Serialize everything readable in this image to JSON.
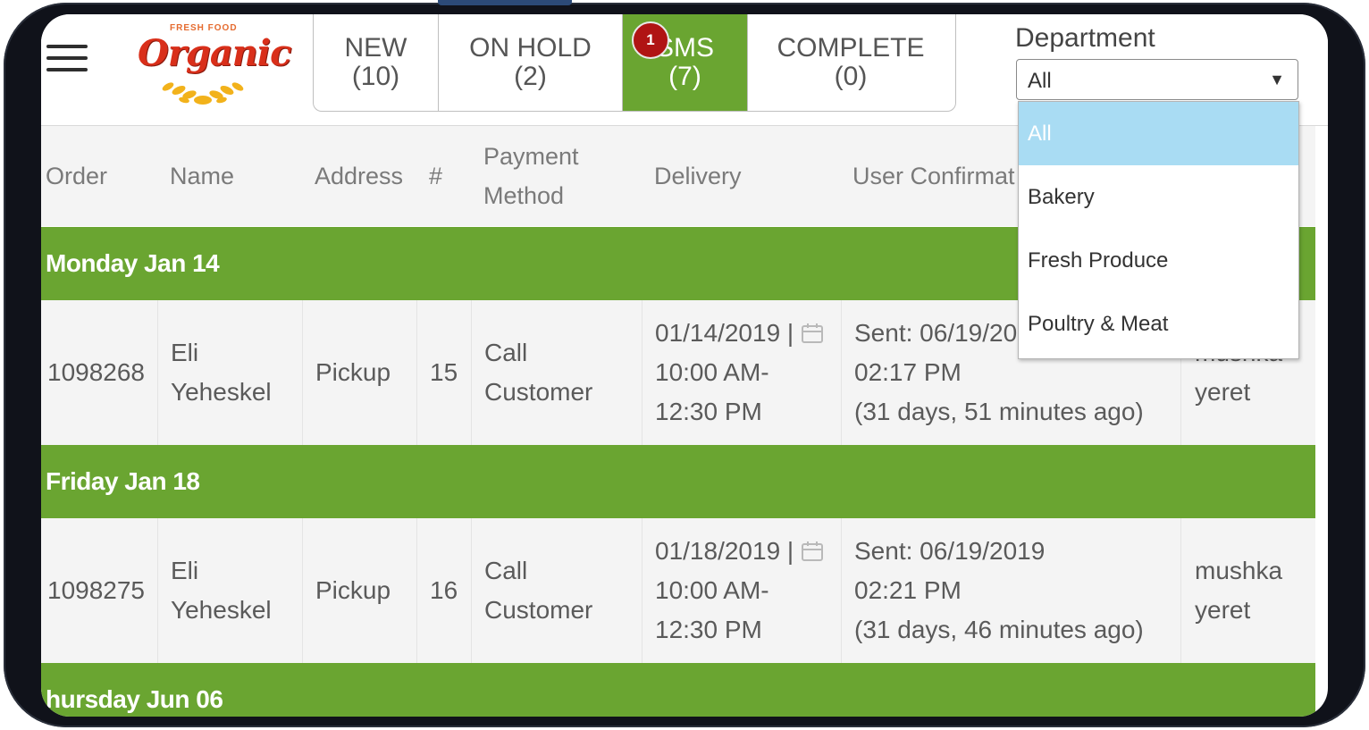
{
  "header": {
    "logo_small": "FRESH FOOD",
    "logo_word": "Organic",
    "tabs": [
      {
        "name": "NEW",
        "count": "(10)"
      },
      {
        "name": "ON HOLD",
        "count": "(2)"
      },
      {
        "name": "SMS",
        "count": "(7)",
        "badge": "1"
      },
      {
        "name": "COMPLETE",
        "count": "(0)"
      }
    ],
    "department": {
      "label": "Department",
      "selected": "All",
      "options": [
        "All",
        "Bakery",
        "Fresh Produce",
        "Poultry & Meat"
      ]
    }
  },
  "table": {
    "columns": [
      "Order",
      "Name",
      "Address",
      "#",
      "Payment Method",
      "Delivery",
      "User Confirmat"
    ],
    "groups": [
      {
        "label": "Monday Jan 14",
        "rows": [
          {
            "order": "1098268",
            "name": "Eli Yeheskel",
            "address": "Pickup",
            "num": "15",
            "payment": "Call Customer",
            "delivery_date": "01/14/2019 |",
            "delivery_time1": "10:00 AM-",
            "delivery_time2": "12:30 PM",
            "sent1": "Sent: 06/19/20",
            "sent2": "02:17 PM",
            "sent3": "(31 days, 51 minutes ago)",
            "user1": "mushka",
            "user2": "yeret"
          }
        ]
      },
      {
        "label": "Friday Jan 18",
        "rows": [
          {
            "order": "1098275",
            "name": "Eli Yeheskel",
            "address": "Pickup",
            "num": "16",
            "payment": "Call Customer",
            "delivery_date": "01/18/2019 |",
            "delivery_time1": "10:00 AM-",
            "delivery_time2": "12:30 PM",
            "sent1": "Sent: 06/19/2019",
            "sent2": "02:21 PM",
            "sent3": "(31 days, 46 minutes ago)",
            "user1": "mushka",
            "user2": "yeret"
          }
        ]
      },
      {
        "label": "hursday Jun 06",
        "rows": []
      }
    ]
  },
  "colors": {
    "accent_green": "#6aa531",
    "badge_red": "#b01414",
    "selected_option": "#a9dcf3"
  }
}
